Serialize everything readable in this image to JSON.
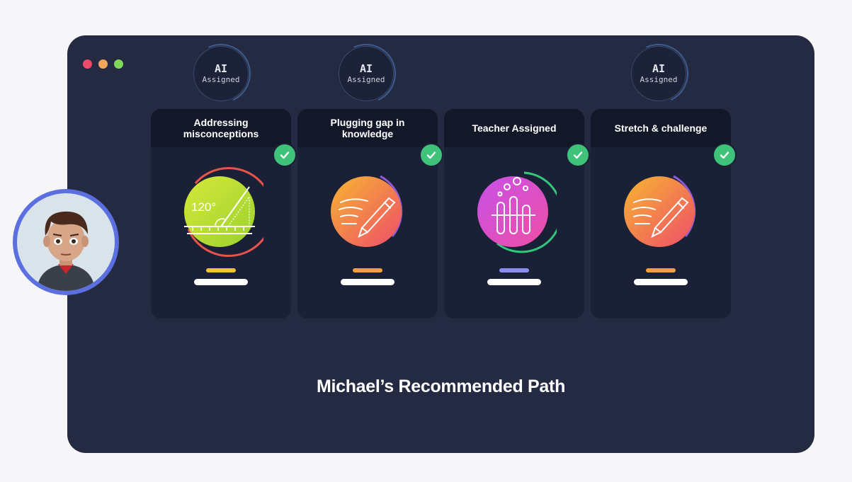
{
  "window": {
    "controls": [
      "close",
      "minimize",
      "maximize"
    ],
    "colors": {
      "close": "#ec4c6a",
      "minimize": "#f2a65a",
      "maximize": "#7ed957"
    }
  },
  "ai_badge": {
    "line1": "AI",
    "line2": "Assigned"
  },
  "cards": [
    {
      "title": "Addressing misconceptions",
      "icon": "protractor-angle-icon",
      "angle_label": "120°",
      "pill_color": "#f4c430",
      "completed": true,
      "ai_assigned": true
    },
    {
      "title": "Plugging gap in knowledge",
      "icon": "pen-writing-icon",
      "pill_color": "#f5a13a",
      "completed": true,
      "ai_assigned": true
    },
    {
      "title": "Teacher Assigned",
      "icon": "test-tubes-icon",
      "pill_color": "#8a8ef0",
      "completed": true,
      "ai_assigned": false
    },
    {
      "title": "Stretch & challenge",
      "icon": "pen-writing-icon",
      "pill_color": "#f5a13a",
      "completed": true,
      "ai_assigned": true
    }
  ],
  "footer": {
    "title": "Michael’s Recommended Path"
  },
  "student": {
    "avatar": "student-avatar-icon"
  }
}
